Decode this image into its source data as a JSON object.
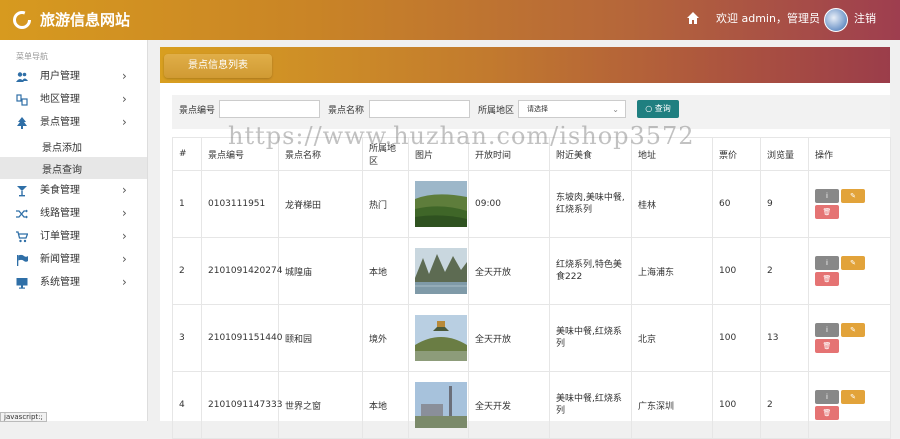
{
  "header": {
    "brand": "旅游信息网站",
    "welcome": "欢迎 admin，管理员",
    "logout": "注销"
  },
  "sidebar": {
    "caption": "菜单导航",
    "items": [
      {
        "label": "用户管理",
        "icon": "users-icon"
      },
      {
        "label": "地区管理",
        "icon": "region-icon"
      },
      {
        "label": "景点管理",
        "icon": "tree-icon"
      },
      {
        "label": "美食管理",
        "icon": "cocktail-icon"
      },
      {
        "label": "线路管理",
        "icon": "shuffle-icon"
      },
      {
        "label": "订单管理",
        "icon": "cart-icon"
      },
      {
        "label": "新闻管理",
        "icon": "flag-icon"
      },
      {
        "label": "系统管理",
        "icon": "monitor-icon"
      }
    ],
    "subitems": [
      {
        "label": "景点添加"
      },
      {
        "label": "景点查询"
      }
    ]
  },
  "status": "javascript:;",
  "panel": {
    "title": "景点信息列表"
  },
  "search": {
    "code_label": "景点编号",
    "name_label": "景点名称",
    "region_label": "所属地区",
    "region_selected": "请选择",
    "query_button": "查询"
  },
  "table": {
    "headers": [
      "#",
      "景点编号",
      "景点名称",
      "所属地区",
      "图片",
      "开放时间",
      "附近美食",
      "地址",
      "票价",
      "浏览量",
      "操作"
    ],
    "rows": [
      {
        "idx": "1",
        "code": "0103111951",
        "name": "龙脊梯田",
        "region": "热门",
        "open": "09:00",
        "food": "东坡肉,美味中餐,红烧系列",
        "addr": "桂林",
        "price": "60",
        "views": "9"
      },
      {
        "idx": "2",
        "code": "2101091420274",
        "name": "城隍庙",
        "region": "本地",
        "open": "全天开放",
        "food": "红烧系列,特色美食222",
        "addr": "上海浦东",
        "price": "100",
        "views": "2"
      },
      {
        "idx": "3",
        "code": "2101091151440",
        "name": "颐和园",
        "region": "境外",
        "open": "全天开放",
        "food": "美味中餐,红烧系列",
        "addr": "北京",
        "price": "100",
        "views": "13"
      },
      {
        "idx": "4",
        "code": "2101091147333",
        "name": "世界之窗",
        "region": "本地",
        "open": "全天开发",
        "food": "美味中餐,红烧系列",
        "addr": "广东深圳",
        "price": "100",
        "views": "2"
      }
    ]
  },
  "watermark": "https://www.huzhan.com/ishop3572",
  "colors": {
    "header_start": "#d79a1f",
    "header_end": "#9e3e4f",
    "query_button": "#1f7f80",
    "edit_button": "#e2a33a",
    "delete_button": "#e57373",
    "info_button": "#888888",
    "icon_blue": "#2f6fa7"
  }
}
